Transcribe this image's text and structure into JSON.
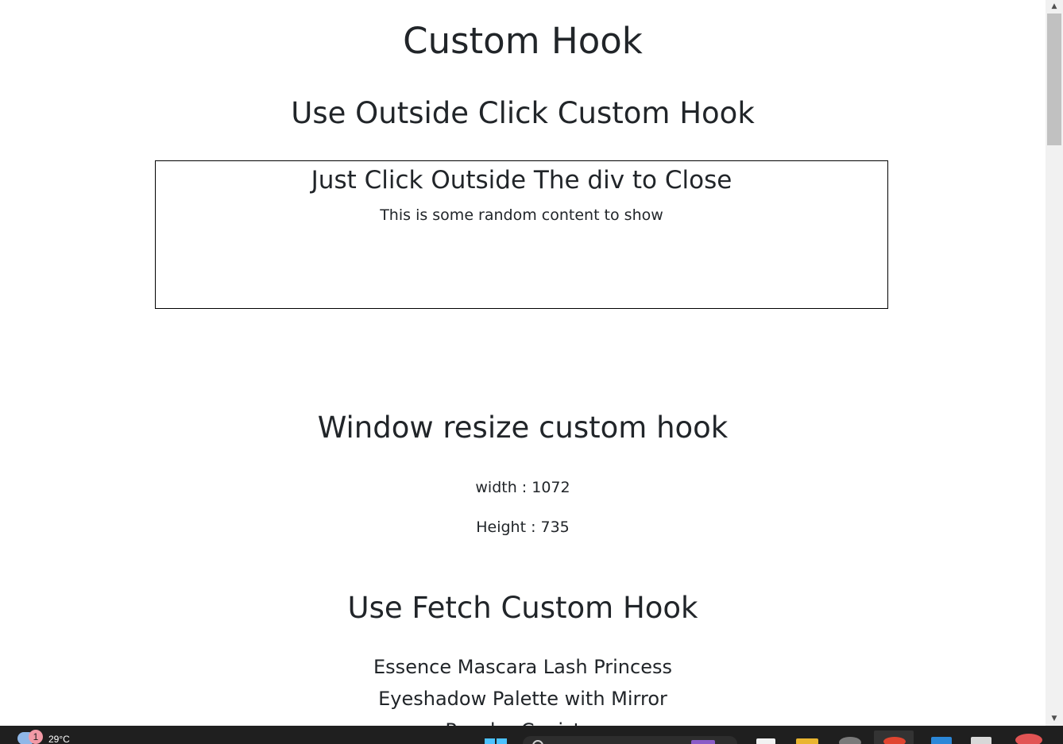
{
  "page": {
    "title": "Custom Hook",
    "outside_click": {
      "heading": "Use Outside Click Custom Hook",
      "box_title": "Just Click Outside The div to Close",
      "box_content": "This is some random content to show"
    },
    "resize": {
      "heading": "Window resize custom hook",
      "width_text": "width : 1072",
      "height_text": "Height : 735"
    },
    "fetch": {
      "heading": "Use Fetch Custom Hook",
      "products": [
        "Essence Mascara Lash Princess",
        "Eyeshadow Palette with Mirror",
        "Powder Canister"
      ]
    }
  },
  "scrollbar": {
    "up_icon": "triangle-up-icon",
    "down_icon": "triangle-down-icon"
  },
  "taskbar": {
    "notification_count": "1",
    "temperature": "29°C",
    "weather_icon": "cloud-icon",
    "start_icon": "windows-icon",
    "search_icon": "search-icon"
  }
}
